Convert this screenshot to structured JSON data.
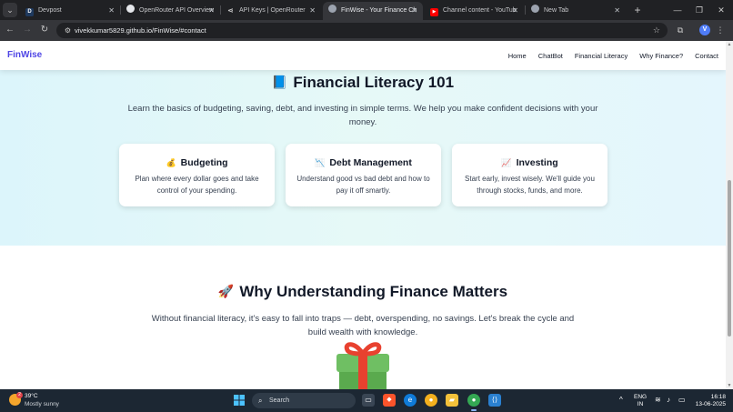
{
  "browser": {
    "tabs": [
      {
        "title": "Devpost",
        "favicon": "devpost",
        "favicon_color": "#1f3a5f",
        "favicon_glyph": "D",
        "active": false
      },
      {
        "title": "OpenRouter API Overview",
        "favicon": "openrouter",
        "favicon_color": "#6b7280",
        "favicon_glyph": "",
        "active": false
      },
      {
        "title": "API Keys | OpenRouter",
        "favicon": "openrouter",
        "favicon_color": "#6b7280",
        "favicon_glyph": "",
        "active": false
      },
      {
        "title": "FinWise - Your Finance Ch",
        "favicon": "finwise",
        "favicon_color": "#9ca3af",
        "favicon_glyph": "",
        "active": true
      },
      {
        "title": "Channel content - YouTub",
        "favicon": "youtube",
        "favicon_color": "#ff0000",
        "favicon_glyph": "▶",
        "active": false
      },
      {
        "title": "New Tab",
        "favicon": "chrome",
        "favicon_color": "#9ca3af",
        "favicon_glyph": "",
        "active": false
      }
    ],
    "url": "vivekkumar5829.github.io/FinWise/#contact",
    "profile_initial": "V"
  },
  "page": {
    "brand": "FinWise",
    "brand_color": "#4f46e5",
    "nav": [
      "Home",
      "ChatBot",
      "Financial Literacy",
      "Why Finance?",
      "Contact"
    ],
    "literacy": {
      "emoji": "📘",
      "title": "Financial Literacy 101",
      "description": "Learn the basics of budgeting, saving, debt, and investing in simple terms. We help you make confident decisions with your money.",
      "cards": [
        {
          "emoji": "💰",
          "title": "Budgeting",
          "text": "Plan where every dollar goes and take control of your spending."
        },
        {
          "emoji": "📉",
          "title": "Debt Management",
          "text": "Understand good vs bad debt and how to pay it off smartly."
        },
        {
          "emoji": "📈",
          "title": "Investing",
          "text": "Start early, invest wisely. We'll guide you through stocks, funds, and more."
        }
      ]
    },
    "why": {
      "emoji": "🚀",
      "title": "Why Understanding Finance Matters",
      "description": "Without financial literacy, it's easy to fall into traps — debt, overspending, no savings. Let's break the cycle and build wealth with knowledge."
    }
  },
  "taskbar": {
    "weather_temp": "39°C",
    "weather_desc": "Mostly sunny",
    "weather_badge": "2",
    "search_label": "Search",
    "lang_line1": "ENG",
    "lang_line2": "IN",
    "time": "16:18",
    "date": "13-06-2025"
  }
}
